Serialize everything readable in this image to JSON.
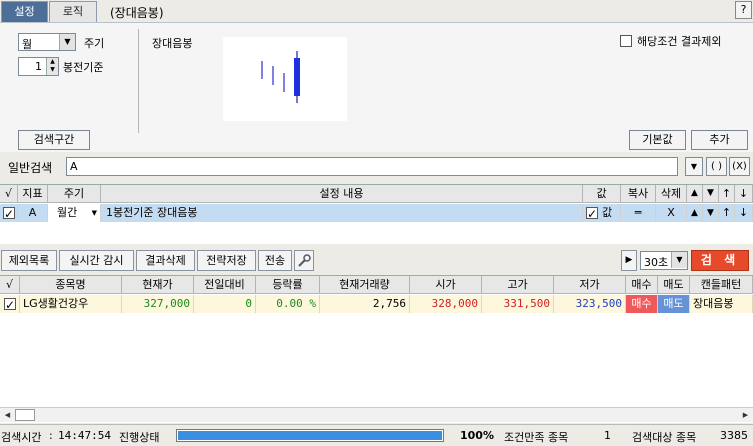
{
  "tabs": [
    "설정",
    "로직"
  ],
  "subtitle": "(장대음봉)",
  "help": "?",
  "settings": {
    "period_value": "월",
    "period_label": "주기",
    "offset_value": "1",
    "offset_label": "봉전기준",
    "condition_name": "장대음봉",
    "exclude_label": "해당조건 결과제외",
    "range_button": "검색구간",
    "default_button": "기본값",
    "add_button": "추가"
  },
  "general_search": {
    "label": "일반검색",
    "value": "A",
    "paren_btn": "( )",
    "x_btn": "(X)"
  },
  "conditions_grid": {
    "headers": [
      "√",
      "지표",
      "주기",
      "설정 내용",
      "값",
      "복사",
      "삭제",
      "▲",
      "▼",
      "↑",
      "↓"
    ],
    "row": {
      "indicator": "A",
      "period": "월간",
      "content": "1봉전기준 장대음봉",
      "value": "값",
      "copy": "═",
      "delete": "X",
      "up": "▲",
      "down": "▼",
      "top": "↑",
      "bottom": "↓"
    }
  },
  "toolbar": {
    "buttons": [
      "제외목록",
      "실시간 감시",
      "결과삭제",
      "전략저장",
      "전송"
    ],
    "interval": "30초",
    "search": "검 색"
  },
  "results_grid": {
    "headers": [
      "√",
      "종목명",
      "현재가",
      "전일대비",
      "등락률",
      "현재거래량",
      "시가",
      "고가",
      "저가",
      "매수",
      "매도",
      "캔들패턴"
    ],
    "rows": [
      {
        "name": "LG생활건강우",
        "price": "327,000",
        "change": "0",
        "rate": "0.00 %",
        "volume": "2,756",
        "open": "328,000",
        "high": "331,500",
        "low": "323,500",
        "buy": "매수",
        "sell": "매도",
        "pattern": "장대음봉"
      }
    ]
  },
  "status": {
    "time_label": "검색시간",
    "time": "14:47:54",
    "state_label": "진행상태",
    "progress_pct": "100%",
    "progress_value": 1.0,
    "satisfied_label": "조건만족 종목",
    "satisfied_count": "1",
    "target_label": "검색대상 종목",
    "target_count": "3385"
  }
}
